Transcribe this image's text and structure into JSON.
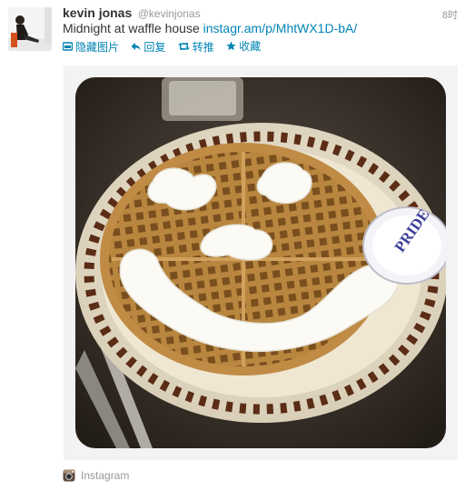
{
  "tweet": {
    "author_name": "kevin jonas",
    "author_handle": "@kevinjonas",
    "time": "8时",
    "text": "Midnight at waffle house",
    "link": "instagr.am/p/MhtWX1D-bA/"
  },
  "actions": [
    {
      "label": "隐藏图片",
      "icon": "image-icon"
    },
    {
      "label": "回复",
      "icon": "reply-icon"
    },
    {
      "label": "转推",
      "icon": "retweet-icon"
    },
    {
      "label": "收藏",
      "icon": "star-icon"
    }
  ],
  "media": {
    "description_icon": "waffle-photo",
    "creamer_label": "PRIDE"
  },
  "source": {
    "label": "Instagram",
    "icon": "instagram-icon"
  },
  "colors": {
    "link": "#0084b4",
    "muted": "#999999",
    "text": "#333333"
  }
}
